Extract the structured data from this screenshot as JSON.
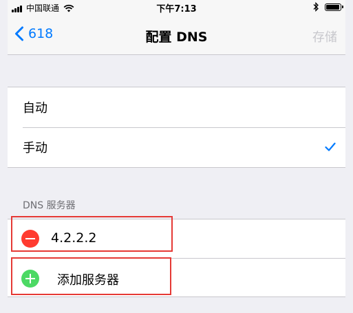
{
  "status_bar": {
    "carrier": "中国联通",
    "time": "下午7:13",
    "battery_level": 0.85
  },
  "nav": {
    "back_label": "618",
    "title": "配置 DNS",
    "save_label": "存储"
  },
  "mode": {
    "options": [
      {
        "label": "自动",
        "selected": false
      },
      {
        "label": "手动",
        "selected": true
      }
    ]
  },
  "dns": {
    "section_header": "DNS 服务器",
    "servers": [
      "4.2.2.2"
    ],
    "add_label": "添加服务器"
  },
  "colors": {
    "accent": "#007aff",
    "delete": "#ff3b30",
    "add": "#4cd964",
    "highlight": "#e53935"
  }
}
